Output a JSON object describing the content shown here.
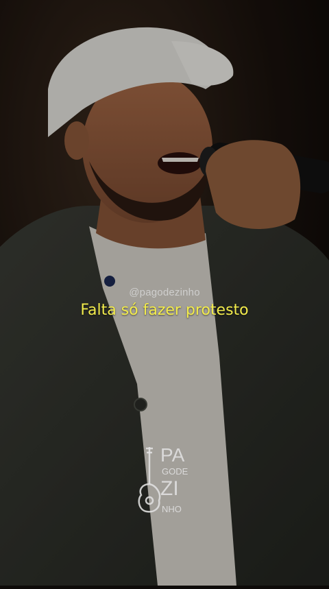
{
  "overlay": {
    "handle": "@pagodezinho",
    "caption": "Falta só fazer protesto"
  },
  "logo": {
    "line1": "PA",
    "line2": "GODE",
    "line3": "ZI",
    "line4": "NHO",
    "icon": "guitar-icon"
  },
  "colors": {
    "caption": "#f3ec4c",
    "background": "#0e0b09"
  }
}
